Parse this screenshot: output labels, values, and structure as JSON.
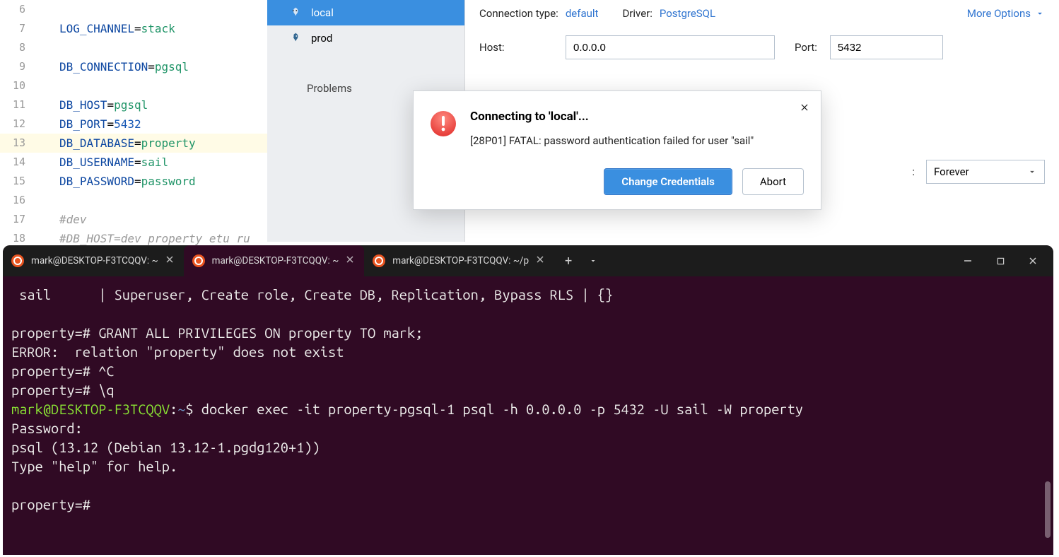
{
  "editor": {
    "lines": [
      {
        "n": "6",
        "html": ""
      },
      {
        "n": "7",
        "html": "<span class='tok-key'>LOG_CHANNEL</span>=<span class='tok-val'>stack</span>"
      },
      {
        "n": "8",
        "html": ""
      },
      {
        "n": "9",
        "html": "<span class='tok-key'>DB_CONNECTION</span>=<span class='tok-val'>pgsql</span>"
      },
      {
        "n": "10",
        "html": ""
      },
      {
        "n": "11",
        "html": "<span class='tok-key'>DB_HOST</span>=<span class='tok-val'>pgsql</span>"
      },
      {
        "n": "12",
        "html": "<span class='tok-key'>DB_PORT</span>=<span class='tok-num'>5432</span>"
      },
      {
        "n": "13",
        "html": "<span class='tok-key'>DB_DATABASE</span>=<span class='tok-val'>property</span>",
        "hl": true
      },
      {
        "n": "14",
        "html": "<span class='tok-key'>DB_USERNAME</span>=<span class='tok-val'>sail</span>"
      },
      {
        "n": "15",
        "html": "<span class='tok-key'>DB_PASSWORD</span>=<span class='tok-val'>password</span>"
      },
      {
        "n": "16",
        "html": ""
      },
      {
        "n": "17",
        "html": "<span class='tok-comment'>#dev</span>"
      },
      {
        "n": "18",
        "html": "<span class='tok-comment'>#DB_HOST=dev property etu ru</span>"
      }
    ]
  },
  "db": {
    "connections": [
      "local",
      "prod"
    ],
    "problems_label": "Problems",
    "conn_type_label": "Connection type:",
    "conn_type_value": "default",
    "driver_label": "Driver:",
    "driver_value": "PostgreSQL",
    "more_options": "More Options",
    "host_label": "Host:",
    "host_value": "0.0.0.0",
    "port_label": "Port:",
    "port_value": "5432",
    "save_label_suffix": ":",
    "save_value": "Forever"
  },
  "dialog": {
    "title": "Connecting to 'local'...",
    "detail": "[28P01] FATAL: password authentication failed for user \"sail\"",
    "primary": "Change Credentials",
    "secondary": "Abort"
  },
  "terminal": {
    "tabs": [
      {
        "title": "mark@DESKTOP-F3TCQQV: ~"
      },
      {
        "title": "mark@DESKTOP-F3TCQQV: ~",
        "active": true
      },
      {
        "title": "mark@DESKTOP-F3TCQQV: ~/p"
      }
    ],
    "lines_html": " <span class='t-white'>sail      | Superuser, Create role, Create DB, Replication, Bypass RLS | {}</span>\n\n<span class='t-white'>property=# GRANT ALL PRIVILEGES ON property TO mark;</span>\n<span class='t-white'>ERROR:  relation \"property\" does not exist</span>\n<span class='t-white'>property=# ^C</span>\n<span class='t-white'>property=# \\q</span>\n<span class='t-green'>mark@DESKTOP-F3TCQQV</span><span class='t-white'>:</span><span class='t-blue'>~</span><span class='t-white'>$ docker exec -it property-pgsql-1 psql -h 0.0.0.0 -p 5432 -U sail -W property</span>\n<span class='t-white'>Password:</span>\n<span class='t-white'>psql (13.12 (Debian 13.12-1.pgdg120+1))</span>\n<span class='t-white'>Type \"help\" for help.</span>\n\n<span class='t-white'>property=#</span>"
  }
}
